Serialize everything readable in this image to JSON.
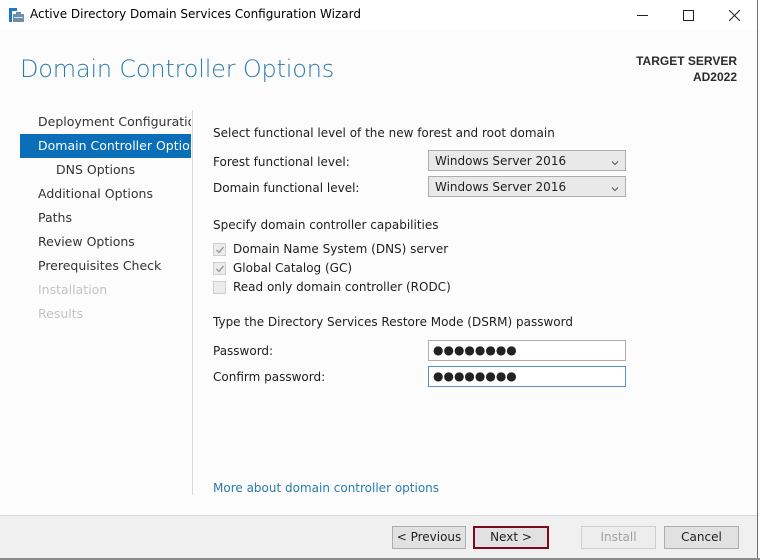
{
  "window": {
    "title": "Active Directory Domain Services Configuration Wizard",
    "icon": "ad-ds-wizard-icon",
    "controls": {
      "minimize": "minimize-icon",
      "maximize": "maximize-icon",
      "close": "close-icon"
    }
  },
  "header": {
    "title": "Domain Controller Options",
    "target_label": "TARGET SERVER",
    "target_name": "AD2022"
  },
  "nav": {
    "items": [
      {
        "label": "Deployment Configuration",
        "state": "normal"
      },
      {
        "label": "Domain Controller Options",
        "state": "active"
      },
      {
        "label": "DNS Options",
        "state": "sub"
      },
      {
        "label": "Additional Options",
        "state": "normal"
      },
      {
        "label": "Paths",
        "state": "normal"
      },
      {
        "label": "Review Options",
        "state": "normal"
      },
      {
        "label": "Prerequisites Check",
        "state": "normal"
      },
      {
        "label": "Installation",
        "state": "disabled"
      },
      {
        "label": "Results",
        "state": "disabled"
      }
    ]
  },
  "functional": {
    "heading": "Select functional level of the new forest and root domain",
    "forest_label": "Forest functional level:",
    "forest_value": "Windows Server 2016",
    "domain_label": "Domain functional level:",
    "domain_value": "Windows Server 2016"
  },
  "capabilities": {
    "heading": "Specify domain controller capabilities",
    "options": [
      {
        "label": "Domain Name System (DNS) server",
        "checked": true,
        "enabled": false
      },
      {
        "label": "Global Catalog (GC)",
        "checked": true,
        "enabled": false
      },
      {
        "label": "Read only domain controller (RODC)",
        "checked": false,
        "enabled": false
      }
    ]
  },
  "dsrm": {
    "heading": "Type the Directory Services Restore Mode (DSRM) password",
    "password_label": "Password:",
    "password_value": "●●●●●●●●",
    "confirm_label": "Confirm password:",
    "confirm_value": "●●●●●●●●"
  },
  "link": {
    "label": "More about domain controller options"
  },
  "footer": {
    "previous": "< Previous",
    "next": "Next >",
    "install": "Install",
    "cancel": "Cancel"
  },
  "colors": {
    "accent": "#0a6fb8",
    "title_blue": "#2b7bad",
    "next_highlight": "#7a0b1e"
  }
}
